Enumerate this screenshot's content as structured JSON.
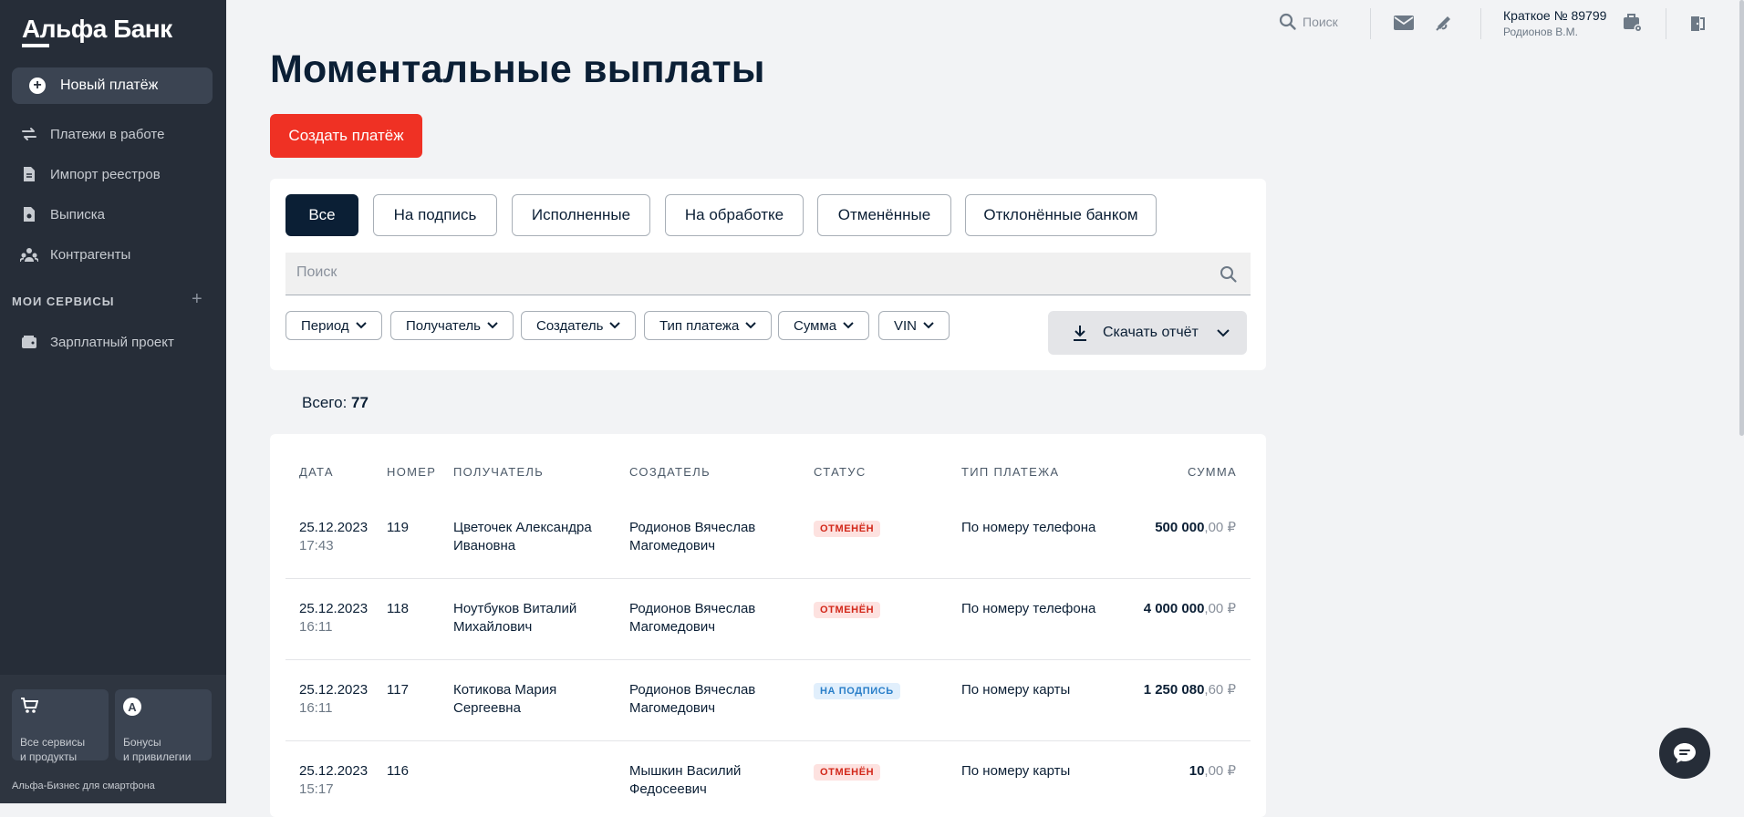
{
  "brand": {
    "logo": "Альфа Банк"
  },
  "sidebar": {
    "new_payment": "Новый платёж",
    "items": [
      {
        "label": "Платежи в работе",
        "icon": "arrows-exchange-icon"
      },
      {
        "label": "Импорт реестров",
        "icon": "import-document-icon"
      },
      {
        "label": "Выписка",
        "icon": "statement-document-icon"
      },
      {
        "label": "Контрагенты",
        "icon": "people-icon"
      }
    ],
    "section_title": "МОИ СЕРВИСЫ",
    "section_add": "+",
    "services": [
      {
        "label": "Зарплатный проект",
        "icon": "wallet-icon"
      }
    ],
    "tiles": [
      {
        "line1": "Все сервисы",
        "line2": "и продукты",
        "icon": "cart-icon"
      },
      {
        "line1": "Бонусы",
        "line2": "и привилегии",
        "icon": "bonus-a-icon",
        "glyph": "A"
      }
    ],
    "footer": "Альфа-Бизнес для смартфона"
  },
  "header": {
    "search_label": "Поиск",
    "account_name": "Краткое № 89799",
    "account_user": "Родионов В.М."
  },
  "page": {
    "title": "Моментальные выплаты",
    "create_button": "Создать платёж"
  },
  "filters": {
    "tabs": [
      "Все",
      "На подпись",
      "Исполненные",
      "На обработке",
      "Отменённые",
      "Отклонённые банком"
    ],
    "active_tab": "Все",
    "search_placeholder": "Поиск",
    "chips": [
      "Период",
      "Получатель",
      "Создатель",
      "Тип платежа",
      "Сумма",
      "VIN"
    ],
    "download": "Скачать отчёт"
  },
  "summary": {
    "label": "Всего:",
    "count": "77"
  },
  "table": {
    "headers": {
      "date": "ДАТА",
      "number": "НОМЕР",
      "recipient": "ПОЛУЧАТЕЛЬ",
      "creator": "СОЗДАТЕЛЬ",
      "status": "СТАТУС",
      "type": "ТИП ПЛАТЕЖА",
      "amount": "СУММА"
    },
    "rows": [
      {
        "date": "25.12.2023",
        "time": "17:43",
        "number": "119",
        "recipient1": "Цветочек Александра",
        "recipient2": "Ивановна",
        "creator1": "Родионов Вячеслав",
        "creator2": "Магомедович",
        "status": "ОТМЕНЁН",
        "type": "По номеру телефона",
        "amount_int": "500 000",
        "amount_frac": ",00 ₽"
      },
      {
        "date": "25.12.2023",
        "time": "16:11",
        "number": "118",
        "recipient1": "Ноутбуков Виталий",
        "recipient2": "Михайлович",
        "creator1": "Родионов Вячеслав",
        "creator2": "Магомедович",
        "status": "ОТМЕНЁН",
        "type": "По номеру телефона",
        "amount_int": "4 000 000",
        "amount_frac": ",00 ₽"
      },
      {
        "date": "25.12.2023",
        "time": "16:11",
        "number": "117",
        "recipient1": "Котикова Мария",
        "recipient2": "Сергеевна",
        "creator1": "Родионов Вячеслав",
        "creator2": "Магомедович",
        "status": "НА ПОДПИСЬ",
        "type": "По номеру карты",
        "amount_int": "1 250 080",
        "amount_frac": ",60 ₽"
      },
      {
        "date": "25.12.2023",
        "time": "15:17",
        "number": "116",
        "recipient1": "",
        "recipient2": "",
        "creator1": "Мышкин Василий",
        "creator2": "Федосеевич",
        "status": "ОТМЕНЁН",
        "type": "По номеру карты",
        "amount_int": "10",
        "amount_frac": ",00 ₽"
      }
    ]
  },
  "colors": {
    "accent": "#ef3124",
    "sidebar": "#262d38",
    "navy": "#0b1f35"
  }
}
